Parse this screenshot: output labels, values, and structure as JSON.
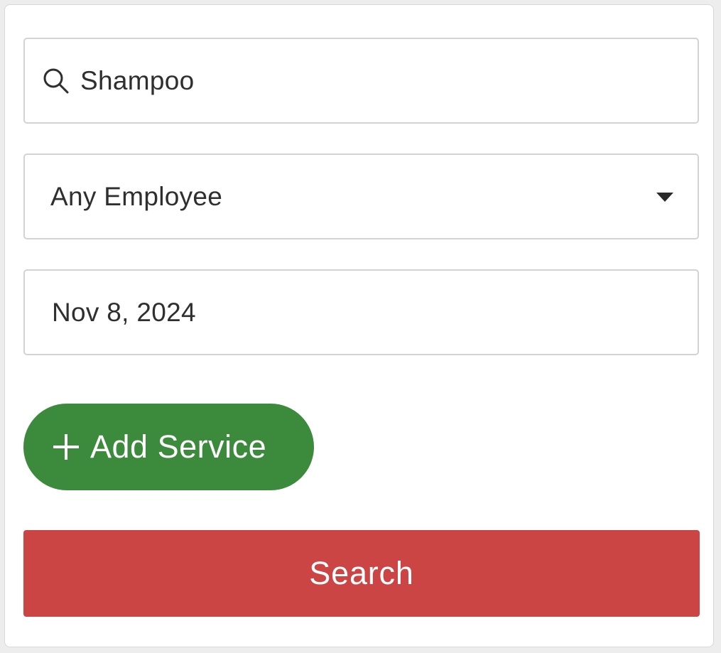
{
  "search": {
    "value": "Shampoo",
    "icon": "search-icon"
  },
  "employee": {
    "selected": "Any Employee",
    "icon": "caret-down-icon"
  },
  "date": {
    "value": "Nov 8, 2024"
  },
  "add_service": {
    "label": "Add Service",
    "icon": "plus-icon",
    "color": "#3c8a3c"
  },
  "search_button": {
    "label": "Search",
    "color": "#cb4544"
  }
}
